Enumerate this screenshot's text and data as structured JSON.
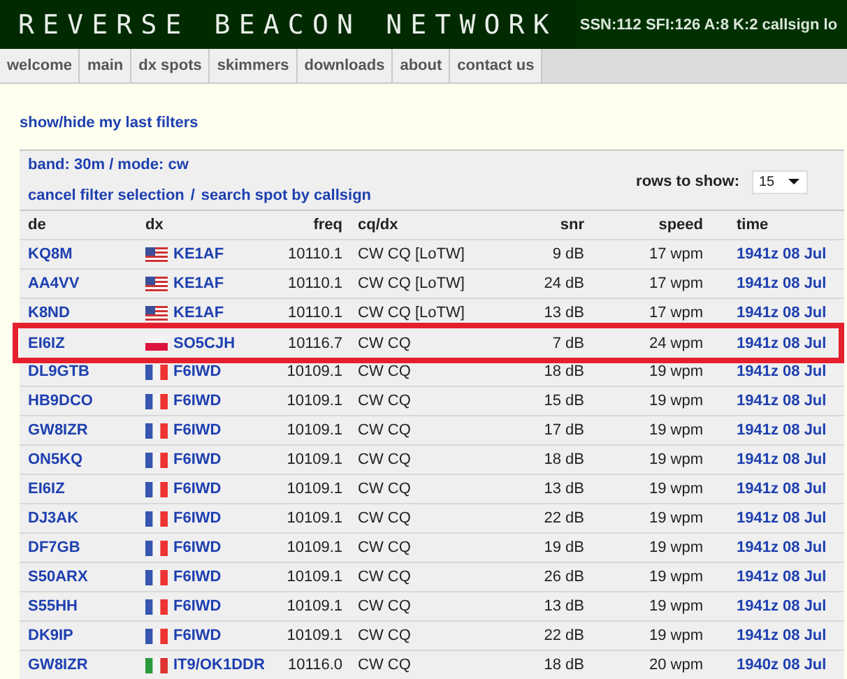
{
  "header": {
    "logo": "REVERSE BEACON NETWORK",
    "stats": "SSN:112 SFI:126 A:8 K:2 callsign lo"
  },
  "nav": [
    "welcome",
    "main",
    "dx spots",
    "skimmers",
    "downloads",
    "about",
    "contact us"
  ],
  "toggle_link": "show/hide my last filters",
  "filters": {
    "band_mode": "band: 30m / mode: cw",
    "cancel_link": "cancel filter selection",
    "separator": "/",
    "search_link": "search spot by callsign",
    "rows_label": "rows to show:",
    "rows_value": "15"
  },
  "table": {
    "columns": [
      "de",
      "dx",
      "freq",
      "cq/dx",
      "snr",
      "speed",
      "time"
    ],
    "rows": [
      {
        "de": "KQ8M",
        "kind": "us",
        "dx": "KE1AF",
        "freq": "10110.1",
        "cq": "CW CQ [LoTW]",
        "snr": "9 dB",
        "speed": "17 wpm",
        "time": "1941z 08 Jul",
        "highlighted": false
      },
      {
        "de": "AA4VV",
        "kind": "us",
        "dx": "KE1AF",
        "freq": "10110.1",
        "cq": "CW CQ [LoTW]",
        "snr": "24 dB",
        "speed": "17 wpm",
        "time": "1941z 08 Jul",
        "highlighted": false
      },
      {
        "de": "K8ND",
        "kind": "us",
        "dx": "KE1AF",
        "freq": "10110.1",
        "cq": "CW CQ [LoTW]",
        "snr": "13 dB",
        "speed": "17 wpm",
        "time": "1941z 08 Jul",
        "highlighted": false
      },
      {
        "de": "EI6IZ",
        "kind": "pl",
        "dx": "SO5CJH",
        "freq": "10116.7",
        "cq": "CW CQ",
        "snr": "7 dB",
        "speed": "24 wpm",
        "time": "1941z 08 Jul",
        "highlighted": true
      },
      {
        "de": "DL9GTB",
        "kind": "fr",
        "dx": "F6IWD",
        "freq": "10109.1",
        "cq": "CW CQ",
        "snr": "18 dB",
        "speed": "19 wpm",
        "time": "1941z 08 Jul",
        "highlighted": false
      },
      {
        "de": "HB9DCO",
        "kind": "fr",
        "dx": "F6IWD",
        "freq": "10109.1",
        "cq": "CW CQ",
        "snr": "15 dB",
        "speed": "19 wpm",
        "time": "1941z 08 Jul",
        "highlighted": false
      },
      {
        "de": "GW8IZR",
        "kind": "fr",
        "dx": "F6IWD",
        "freq": "10109.1",
        "cq": "CW CQ",
        "snr": "17 dB",
        "speed": "19 wpm",
        "time": "1941z 08 Jul",
        "highlighted": false
      },
      {
        "de": "ON5KQ",
        "kind": "fr",
        "dx": "F6IWD",
        "freq": "10109.1",
        "cq": "CW CQ",
        "snr": "18 dB",
        "speed": "19 wpm",
        "time": "1941z 08 Jul",
        "highlighted": false
      },
      {
        "de": "EI6IZ",
        "kind": "fr",
        "dx": "F6IWD",
        "freq": "10109.1",
        "cq": "CW CQ",
        "snr": "13 dB",
        "speed": "19 wpm",
        "time": "1941z 08 Jul",
        "highlighted": false
      },
      {
        "de": "DJ3AK",
        "kind": "fr",
        "dx": "F6IWD",
        "freq": "10109.1",
        "cq": "CW CQ",
        "snr": "22 dB",
        "speed": "19 wpm",
        "time": "1941z 08 Jul",
        "highlighted": false
      },
      {
        "de": "DF7GB",
        "kind": "fr",
        "dx": "F6IWD",
        "freq": "10109.1",
        "cq": "CW CQ",
        "snr": "19 dB",
        "speed": "19 wpm",
        "time": "1941z 08 Jul",
        "highlighted": false
      },
      {
        "de": "S50ARX",
        "kind": "fr",
        "dx": "F6IWD",
        "freq": "10109.1",
        "cq": "CW CQ",
        "snr": "26 dB",
        "speed": "19 wpm",
        "time": "1941z 08 Jul",
        "highlighted": false
      },
      {
        "de": "S55HH",
        "kind": "fr",
        "dx": "F6IWD",
        "freq": "10109.1",
        "cq": "CW CQ",
        "snr": "13 dB",
        "speed": "19 wpm",
        "time": "1941z 08 Jul",
        "highlighted": false
      },
      {
        "de": "DK9IP",
        "kind": "fr",
        "dx": "F6IWD",
        "freq": "10109.1",
        "cq": "CW CQ",
        "snr": "22 dB",
        "speed": "19 wpm",
        "time": "1941z 08 Jul",
        "highlighted": false
      },
      {
        "de": "GW8IZR",
        "kind": "it",
        "dx": "IT9/OK1DDR",
        "freq": "10116.0",
        "cq": "CW CQ",
        "snr": "18 dB",
        "speed": "20 wpm",
        "time": "1940z 08 Jul",
        "highlighted": false
      }
    ]
  }
}
